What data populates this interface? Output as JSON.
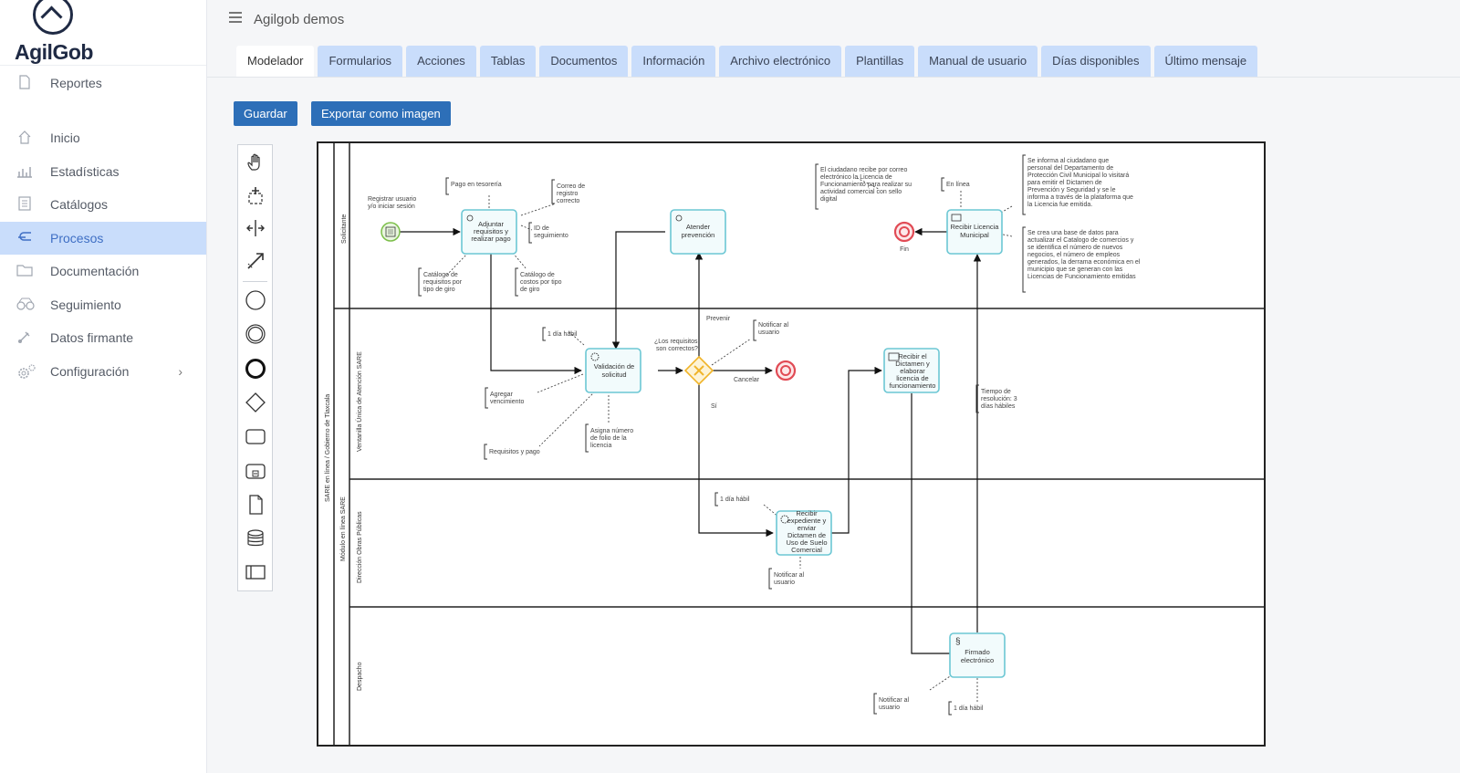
{
  "sidebar": {
    "brand": "AgilGob",
    "items": [
      {
        "label": "Reportes",
        "icon": "document-icon"
      },
      {
        "label": "Inicio",
        "icon": "home-icon"
      },
      {
        "label": "Estadísticas",
        "icon": "chart-icon"
      },
      {
        "label": "Catálogos",
        "icon": "catalog-icon"
      },
      {
        "label": "Procesos",
        "icon": "process-icon",
        "active": true
      },
      {
        "label": "Documentación",
        "icon": "folder-icon"
      },
      {
        "label": "Seguimiento",
        "icon": "tracking-icon"
      },
      {
        "label": "Datos firmante",
        "icon": "signature-icon"
      },
      {
        "label": "Configuración",
        "icon": "gear-icon"
      }
    ]
  },
  "header": {
    "title": "Agilgob demos"
  },
  "tabs": [
    "Modelador",
    "Formularios",
    "Acciones",
    "Tablas",
    "Documentos",
    "Información",
    "Archivo electrónico",
    "Plantillas",
    "Manual de usuario",
    "Días disponibles",
    "Último mensaje"
  ],
  "toolbar": {
    "save_label": "Guardar",
    "export_label": "Exportar como imagen"
  },
  "diagram": {
    "pool_outer": "SARE en línea / Gobierno de Tlaxcala",
    "pool_inner": "Módulo en línea SARE",
    "lanes": [
      "Solicitante",
      "Ventanilla Única de Atención SARE",
      "Dirección Obras Públicas",
      "Despacho"
    ],
    "tasks": {
      "adjuntar": "Adjuntar requisitos y realizar pago",
      "atender": "Atender prevención",
      "recibir_licencia": "Recibir Licencia Municipal",
      "validacion": "Validación de solicitud",
      "dictamen": "Recibir el Dictamen y elaborar licencia de funcionamiento",
      "expediente": "Recibir expediente y enviar Dictamen de Uso de Suelo Comercial",
      "firmado": "Firmado electrónico"
    },
    "events": {
      "start": "Registrar usuario y/o iniciar sesión",
      "fin": "Fin"
    },
    "gateway": "¿Los requisitos son correctos?",
    "flows": {
      "prevenir": "Prevenir",
      "cancelar": "Cancelar",
      "si": "Sí"
    },
    "annotations": {
      "pago": "Pago en tesorería",
      "correo": "Correo de registro correcto",
      "id": "ID de seguimiento",
      "cat_req": "Catálogo de requisitos por tipo de giro",
      "cat_costos": "Catálogo de costos por tipo de giro",
      "ciudadano": "El ciudadano recibe por correo electrónico la Licencia de Funcionamiento para realizar su actividad comercial con sello digital",
      "en_linea": "En línea",
      "informa": "Se informa al ciudadano que personal del Departamento de Protección Civil Municipal lo visitará para emitir el Dictamen de Prevención y Seguridad y se le informa a través de la plataforma que la Licencia fue emitida.",
      "base": "Se crea una base de datos para actualizar el Catálogo de comercios y se identifica el número de nuevos negocios, el número de empleos generados, la derrama económica en el municipio que se generan con las Licencias de Funcionamiento emitidas",
      "dia1": "1 día hábil",
      "notificar": "Notificar al usuario",
      "agregar": "Agregar vencimiento",
      "asigna": "Asigna número de folio de la licencia",
      "requisitos_pago": "Requisitos y pago",
      "tiempo": "Tiempo de resolución: 3 días hábiles"
    }
  },
  "colors": {
    "accent": "#2d6fb8",
    "tab": "#c9ddfb",
    "task_border": "#6cc7d4",
    "end": "#e14b55",
    "start": "#7cbf4a",
    "gateway": "#f0b429"
  }
}
